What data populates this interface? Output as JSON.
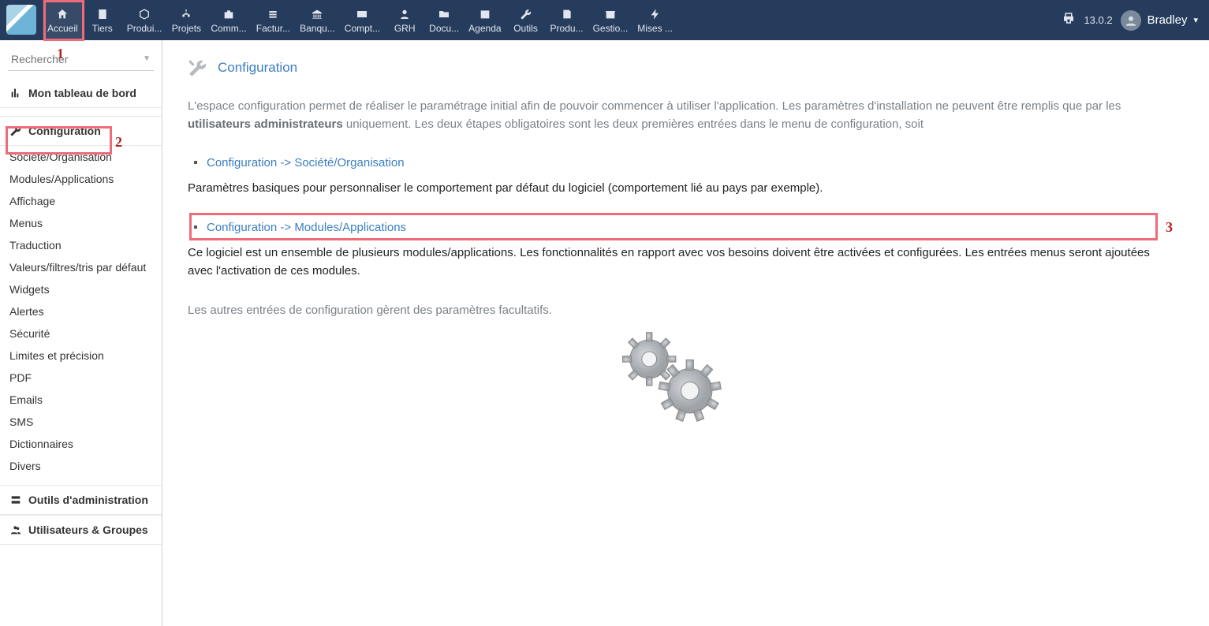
{
  "version": "13.0.2",
  "user_name": "Bradley",
  "search_placeholder": "Rechercher",
  "topnav": [
    {
      "label": "Accueil"
    },
    {
      "label": "Tiers"
    },
    {
      "label": "Produi..."
    },
    {
      "label": "Projets"
    },
    {
      "label": "Comm..."
    },
    {
      "label": "Factur..."
    },
    {
      "label": "Banqu..."
    },
    {
      "label": "Compt..."
    },
    {
      "label": "GRH"
    },
    {
      "label": "Docu..."
    },
    {
      "label": "Agenda"
    },
    {
      "label": "Outils"
    },
    {
      "label": "Produ..."
    },
    {
      "label": "Gestio..."
    },
    {
      "label": "Mises ..."
    }
  ],
  "sidebar": {
    "dashboard": "Mon tableau de bord",
    "config_label": "Configuration",
    "config_items": [
      "Société/Organisation",
      "Modules/Applications",
      "Affichage",
      "Menus",
      "Traduction",
      "Valeurs/filtres/tris par défaut",
      "Widgets",
      "Alertes",
      "Sécurité",
      "Limites et précision",
      "PDF",
      "Emails",
      "SMS",
      "Dictionnaires",
      "Divers"
    ],
    "admin_tools": "Outils d'administration",
    "users_groups": "Utilisateurs & Groupes"
  },
  "page": {
    "title": "Configuration",
    "intro_part1": "L'espace configuration permet de réaliser le paramétrage initial afin de pouvoir commencer à utiliser l'application. Les paramètres d'installation ne peuvent être remplis que par les ",
    "intro_strong": "utilisateurs administrateurs",
    "intro_part2": " uniquement. Les deux étapes obligatoires sont les deux premières entrées dans le menu de configuration, soit",
    "link1": "Configuration -> Société/Organisation",
    "desc1": "Paramètres basiques pour personnaliser le comportement par défaut du logiciel (comportement lié au pays par exemple).",
    "link2": "Configuration -> Modules/Applications",
    "desc2": "Ce logiciel est un ensemble de plusieurs modules/applications. Les fonctionnalités en rapport avec vos besoins doivent être activées et configurées. Les entrées menus seront ajoutées avec l'activation de ces modules.",
    "outro": "Les autres entrées de configuration gèrent des paramètres facultatifs."
  },
  "annotations": {
    "n1": "1",
    "n2": "2",
    "n3": "3"
  }
}
